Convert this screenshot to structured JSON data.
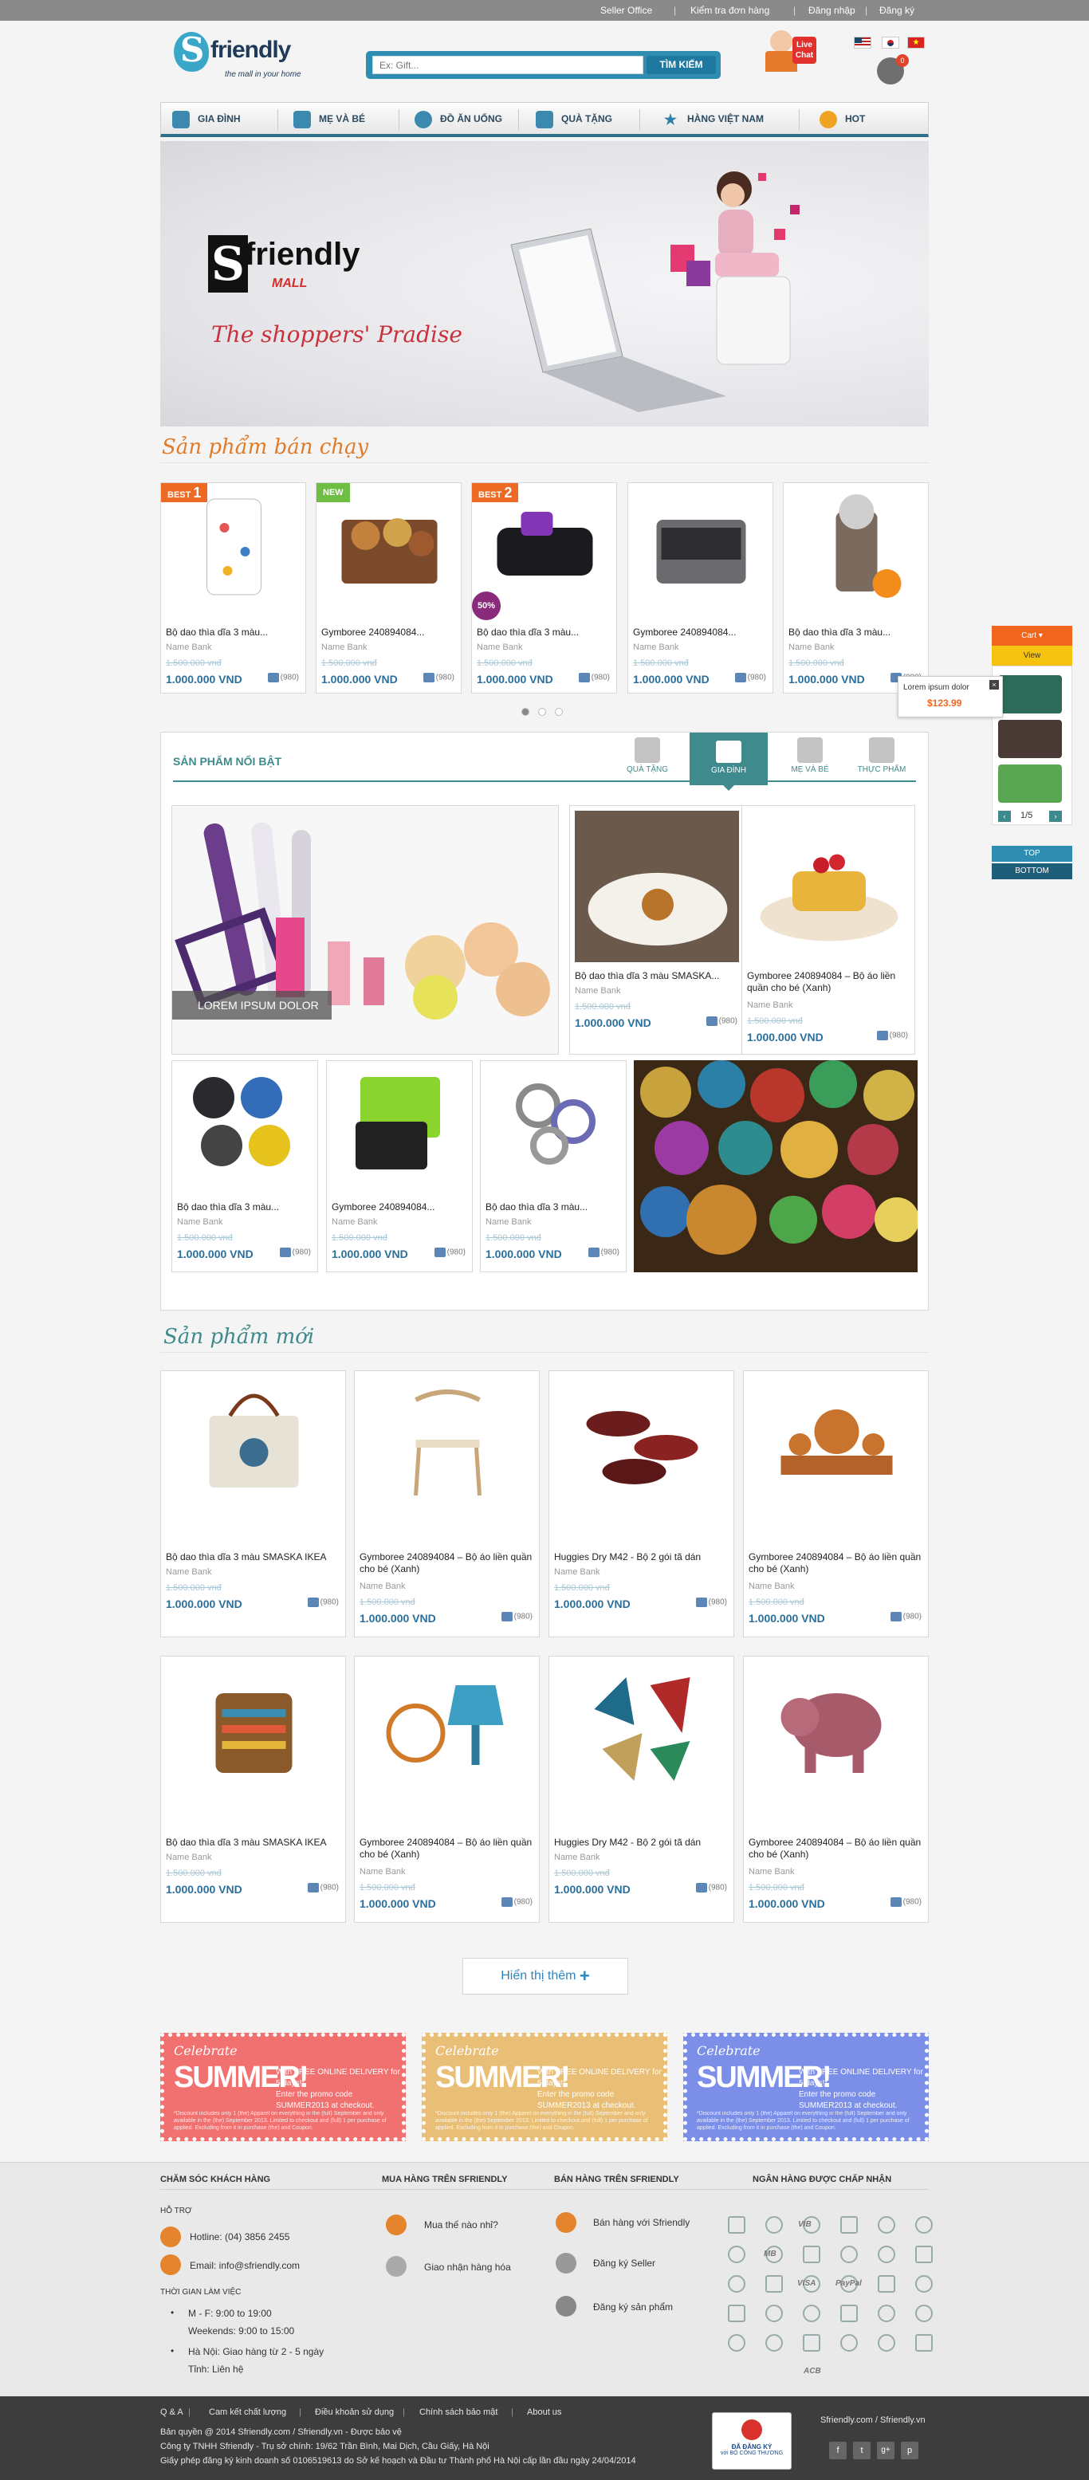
{
  "topbar": {
    "seller": "Seller Office",
    "track": "Kiểm tra đơn hàng",
    "login": "Đăng nhập",
    "register": "Đăng ký"
  },
  "header": {
    "logo_text": "friendly",
    "logo_letter": "S",
    "logo_tagline": "the mall in your home",
    "search_placeholder": "Ex: Gift...",
    "search_button": "TÌM KIẾM",
    "live_chat": "Live Chat",
    "cart_count": "0",
    "accent": "#2d6f86"
  },
  "nav": [
    "GIA ĐÌNH",
    "MẸ VÀ BÉ",
    "ĐỒ ĂN UỐNG",
    "QUÀ TẶNG",
    "HÀNG VIỆT NAM",
    "HOT"
  ],
  "banner": {
    "brand_letter": "S",
    "brand_rest": "friendly",
    "brand_sub": "MALL",
    "slogan": "The shoppers' Pradise"
  },
  "bestsellers": {
    "title": "Sản phẩm bán chạy",
    "items": [
      {
        "badge": "BEST",
        "badge_num": "1",
        "name": "Bộ dao thìa dĩa 3 màu...",
        "bank": "Name Bank",
        "old": "1.500.000 vnđ",
        "price": "1.000.000 VND",
        "likes": "(980)"
      },
      {
        "badge": "NEW",
        "badge_num": "",
        "name": "Gymboree 240894084...",
        "bank": "Name Bank",
        "old": "1.500.000 vnđ",
        "price": "1.000.000 VND",
        "likes": "(980)"
      },
      {
        "badge": "BEST",
        "badge_num": "2",
        "name": "Bộ dao thìa dĩa 3 màu...",
        "bank": "Name Bank",
        "old": "1.500.000 vnđ",
        "price": "1.000.000 VND",
        "likes": "(980)",
        "sale": "50%"
      },
      {
        "badge": "",
        "badge_num": "",
        "name": "Gymboree 240894084...",
        "bank": "Name Bank",
        "old": "1.500.000 vnđ",
        "price": "1.000.000 VND",
        "likes": "(980)"
      },
      {
        "badge": "",
        "badge_num": "",
        "name": "Bộ dao thìa dĩa 3 màu...",
        "bank": "Name Bank",
        "old": "1.500.000 vnđ",
        "price": "1.000.000 VND",
        "likes": "(980)"
      }
    ]
  },
  "featured": {
    "title": "SẢN PHẨM NỔI BẬT",
    "tabs": [
      "QUÀ TẶNG",
      "GIA ĐÌNH",
      "MẸ VÀ BÉ",
      "THỰC PHẨM"
    ],
    "big_caption": "LOREM IPSUM DOLOR",
    "items": [
      {
        "name": "Bộ dao thìa dĩa 3 màu SMASKA...",
        "bank": "Name Bank",
        "old": "1.500.000 vnđ",
        "price": "1.000.000 VND",
        "likes": "(980)"
      },
      {
        "name": "Gymboree 240894084 – Bộ áo liền quần cho bé (Xanh)",
        "bank": "Name Bank",
        "old": "1.500.000 vnđ",
        "price": "1.000.000 VND",
        "likes": "(980)"
      },
      {
        "name": "Bộ dao thìa dĩa 3 màu...",
        "bank": "Name Bank",
        "old": "1.500.000 vnđ",
        "price": "1.000.000 VND",
        "likes": "(980)"
      },
      {
        "name": "Gymboree 240894084...",
        "bank": "Name Bank",
        "old": "1.500.000 vnđ",
        "price": "1.000.000 VND",
        "likes": "(980)"
      },
      {
        "name": "Bộ dao thìa dĩa 3 màu...",
        "bank": "Name Bank",
        "old": "1.500.000 vnđ",
        "price": "1.000.000 VND",
        "likes": "(980)"
      }
    ]
  },
  "newproducts": {
    "title": "Sản phẩm mới",
    "items": [
      {
        "name": "Bộ dao thìa dĩa 3 màu SMASKA IKEA",
        "bank": "Name Bank",
        "old": "1.500.000 vnđ",
        "price": "1.000.000 VND",
        "likes": "(980)"
      },
      {
        "name": "Gymboree 240894084 – Bộ áo liền quần cho bé (Xanh)",
        "bank": "Name Bank",
        "old": "1.500.000 vnđ",
        "price": "1.000.000 VND",
        "likes": "(980)"
      },
      {
        "name": "Huggies Dry M42 - Bộ 2 gói tã dán",
        "bank": "Name Bank",
        "old": "1.500.000 vnđ",
        "price": "1.000.000 VND",
        "likes": "(980)"
      },
      {
        "name": "Gymboree 240894084 – Bộ áo liền quần cho bé (Xanh)",
        "bank": "Name Bank",
        "old": "1.500.000 vnđ",
        "price": "1.000.000 VND",
        "likes": "(980)"
      },
      {
        "name": "Bộ dao thìa dĩa 3 màu SMASKA IKEA",
        "bank": "Name Bank",
        "old": "1.500.000 vnđ",
        "price": "1.000.000 VND",
        "likes": "(980)"
      },
      {
        "name": "Gymboree 240894084 – Bộ áo liền quần cho bé (Xanh)",
        "bank": "Name Bank",
        "old": "1.500.000 vnđ",
        "price": "1.000.000 VND",
        "likes": "(980)"
      },
      {
        "name": "Huggies Dry M42 - Bộ 2 gói tã dán",
        "bank": "Name Bank",
        "old": "1.500.000 vnđ",
        "price": "1.000.000 VND",
        "likes": "(980)"
      },
      {
        "name": "Gymboree 240894084 – Bộ áo liền quần cho bé (Xanh)",
        "bank": "Name Bank",
        "old": "1.500.000 vnđ",
        "price": "1.000.000 VND",
        "likes": "(980)"
      }
    ],
    "more_button": "Hiển thị thêm"
  },
  "coupons": [
    {
      "celebrate": "Celebrate",
      "summer": "SUMMER!",
      "offer": "With FREE ONLINE DELIVERY for 5 days!*",
      "promo": "Enter the promo code SUMMER2013 at checkout.",
      "fine": "*Discount includes only 1 (the) Apparel on everything in the (full) September and only available in the (the) September 2013. Limited to checkout and (full) 1 per purchase of applied. Excluding from it in purchase (the) and Coupon.",
      "color": "#f07170"
    },
    {
      "celebrate": "Celebrate",
      "summer": "SUMMER!",
      "offer": "With FREE ONLINE DELIVERY for 5 days!*",
      "promo": "Enter the promo code SUMMER2013 at checkout.",
      "fine": "*Discount includes only 1 (the) Apparel on everything in the (full) September and only available in the (the) September 2013. Limited to checkout and (full) 1 per purchase of applied. Excluding from it in purchase (the) and Coupon.",
      "color": "#e9be76"
    },
    {
      "celebrate": "Celebrate",
      "summer": "SUMMER!",
      "offer": "With FREE ONLINE DELIVERY for 5 days!*",
      "promo": "Enter the promo code SUMMER2013 at checkout.",
      "fine": "*Discount includes only 1 (the) Apparel on everything in the (full) September and only available in the (the) September 2013. Limited to checkout and (full) 1 per purchase of applied. Excluding from it in purchase (the) and Coupon.",
      "color": "#7b8ee8"
    }
  ],
  "footer": {
    "care": {
      "title": "Chăm sóc khách hàng",
      "support": "HỖ TRỢ",
      "hotline": "Hotline:  (04) 3856 2455",
      "email": "Email: info@sfriendly.com",
      "hours_title": "THỜI GIAN LÀM VIỆC",
      "mf": "M - F: 9:00 to 19:00",
      "weekends": "Weekends: 9:00 to 15:00",
      "hanoi": "Hà Nội: Giao hàng từ 2 - 5 ngày",
      "province": "Tỉnh: Liên hệ"
    },
    "buy": {
      "title": "Mua hàng trên Sfriendly",
      "items": [
        "Mua thế nào nhỉ?",
        "Giao nhận hàng hóa"
      ]
    },
    "sell": {
      "title": "Bán hàng trên Sfriendly",
      "items": [
        "Bán hàng với Sfriendly",
        "Đăng ký Seller",
        "Đăng ký sản phẩm"
      ]
    },
    "banks": {
      "title": "Ngân hàng được chấp nhận",
      "labels": [
        "MB",
        "VIB",
        "VISA",
        "PayPal",
        "ACB"
      ]
    },
    "links": [
      "Q & A",
      "Cam kết chất lượng",
      "Điều khoản sử dụng",
      "Chính sách bảo mật",
      "About us"
    ],
    "copyright": "Bản quyền @ 2014 Sfriendly.com / Sfriendly.vn - Được bảo vệ",
    "company": "Công ty TNHH Sfriendly - Trụ sở chính: 19/62 Trần Bình, Mai Dịch, Cầu Giấy, Hà Nội",
    "license": "Giấy phép đăng ký kinh doanh số 0106519613 do Sở kế hoạch và Đầu tư Thành phố Hà Nội cấp lần đầu ngày 24/04/2014",
    "registered": "ĐÃ ĐĂNG KÝ",
    "ministry": "với BỘ CÔNG THƯƠNG",
    "domain": "Sfriendly.com / Sfriendly.vn"
  },
  "side": {
    "cart": "Cart",
    "view": "View",
    "item_name": "Lorem ipsum dolor",
    "item_price": "$123.99",
    "pager": "1/5",
    "top": "TOP",
    "bottom": "BOTTOM"
  }
}
